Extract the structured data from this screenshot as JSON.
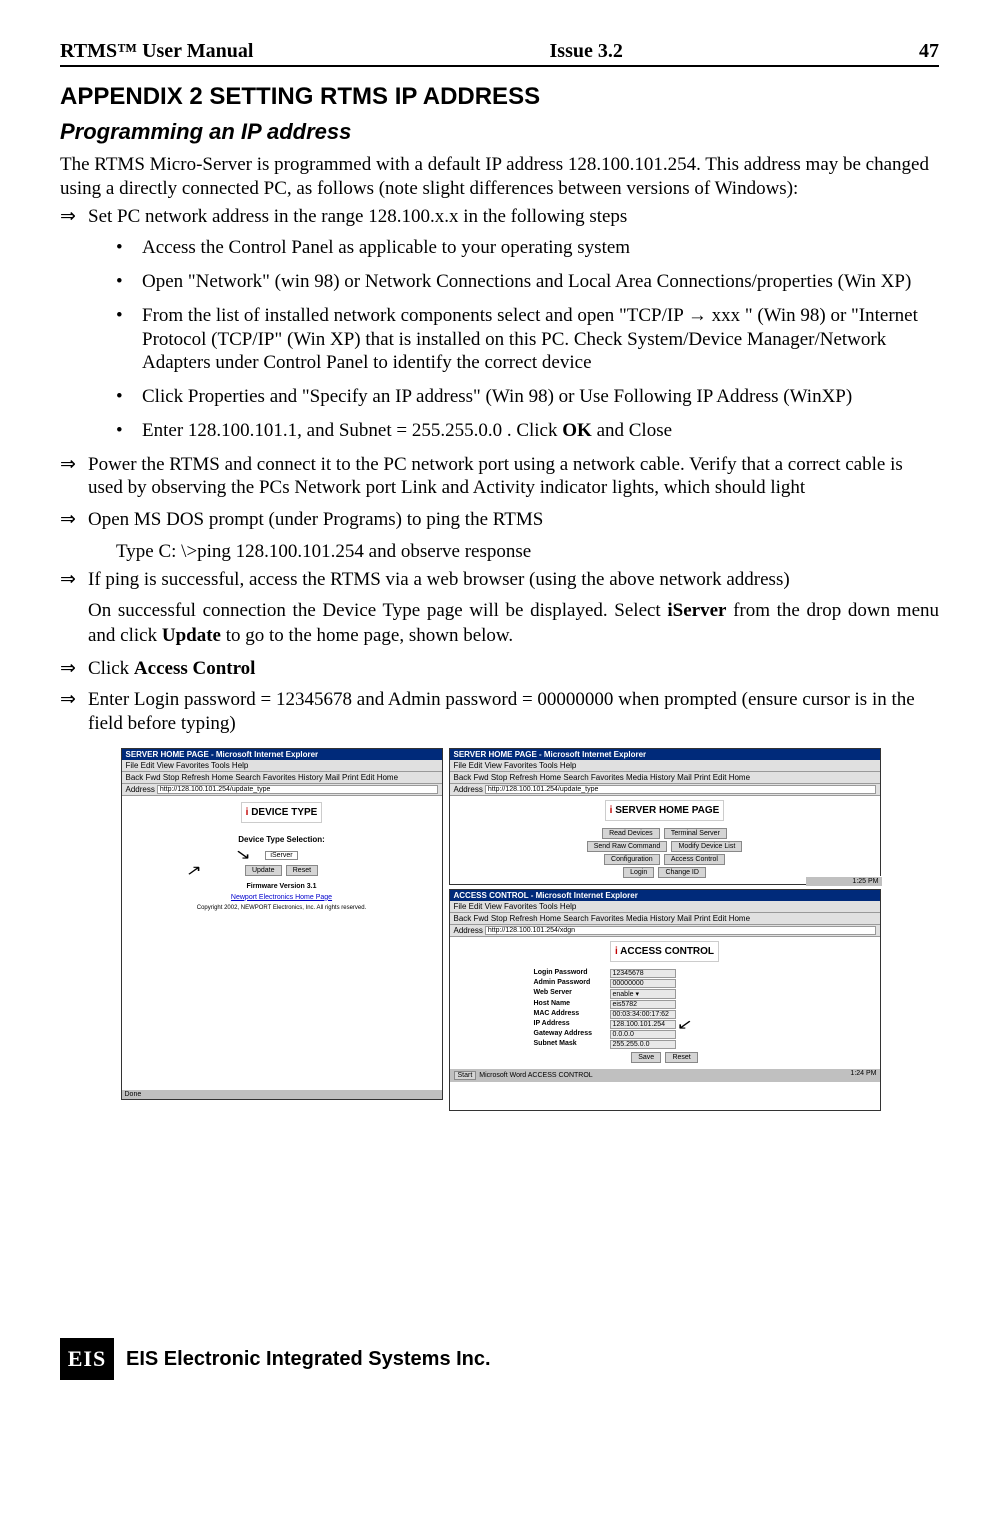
{
  "header": {
    "left": "RTMS™ User Manual",
    "center": "Issue 3.2",
    "right": "47"
  },
  "title": "APPENDIX 2     SETTING RTMS IP ADDRESS",
  "subtitle": "Programming an IP address",
  "intro": "The RTMS Micro-Server is programmed with a default IP address 128.100.101.254. This address may be changed using a directly connected PC, as follows (note slight differences between versions of Windows):",
  "arrows": {
    "a1": "Set PC network address in the range 128.100.x.x  in the following steps",
    "a2": "Power the RTMS and connect it to the PC network port using a network cable.  Verify that a correct cable is used by observing the PCs Network port Link and Activity indicator lights, which should light",
    "a3": "Open MS DOS prompt (under Programs)  to ping the RTMS",
    "a4": "If ping is successful, access the RTMS via a web browser (using the above network address)",
    "a5_pre": "Click  ",
    "a5_bold": "Access Control",
    "a6": "Enter Login password = 12345678 and Admin password = 00000000 when prompted (ensure cursor is in the field before typing)"
  },
  "bullets": {
    "b1": "Access the Control Panel as applicable to your operating system",
    "b2": "Open  \"Network\" (win 98) or Network Connections and Local Area Connections/properties (Win XP)",
    "b3": "From the list of installed network components select and open  \"TCP/IP → xxx \" (Win 98) or \"Internet Protocol (TCP/IP\" (Win XP) that is installed on this PC.   Check System/Device Manager/Network Adapters under Control Panel to identify the correct device",
    "b4": "Click Properties and \"Specify an IP address\"  (Win 98) or Use Following IP Address (WinXP)",
    "b5_pre": "Enter 128.100.101.1, and Subnet  = 255.255.0.0 .  Click ",
    "b5_bold": "OK",
    "b5_post": " and Close"
  },
  "indent1": "Type C: \\>ping 128.100.101.254 and observe response",
  "arrow_indent": {
    "pre": "On successful connection the Device Type page will be displayed. Select ",
    "bold1": "iServer",
    "mid": " from the drop down menu and click ",
    "bold2": "Update",
    "post": " to go to the home page, shown below."
  },
  "shots": {
    "w1": {
      "title": "SERVER HOME PAGE - Microsoft Internet Explorer",
      "menu": "File  Edit  View  Favorites  Tools  Help",
      "toolbar": "Back  Fwd  Stop  Refresh  Home  Search  Favorites  History  Mail  Print  Edit Home",
      "addr_label": "Address",
      "addr": "http://128.100.101.254/update_type",
      "heading": "DEVICE TYPE",
      "selection_label": "Device Type Selection:",
      "select_value": "iServer",
      "btn_update": "Update",
      "btn_reset": "Reset",
      "fw": "Firmware Version 3.1",
      "link": "Newport Electronics Home Page",
      "copyright": "Copyright 2002, NEWPORT Electronics, Inc. All rights reserved.",
      "status": "Done"
    },
    "w2": {
      "title": "SERVER HOME PAGE - Microsoft Internet Explorer",
      "menu": "File  Edit  View  Favorites  Tools  Help",
      "toolbar": "Back  Fwd  Stop  Refresh  Home  Search  Favorites  Media  History  Mail  Print  Edit Home",
      "addr_label": "Address",
      "addr": "http://128.100.101.254/update_type",
      "heading": "SERVER HOME PAGE",
      "btns": {
        "b1": "Read Devices",
        "b2": "Terminal Server",
        "b3": "Send Raw Command",
        "b4": "Modify Device List",
        "b5": "Configuration",
        "b6": "Access Control",
        "b7": "Login",
        "b8": "Change ID"
      },
      "taskbar_time": "1:25 PM"
    },
    "w3": {
      "title": "ACCESS CONTROL - Microsoft Internet Explorer",
      "menu": "File  Edit  View  Favorites  Tools  Help",
      "toolbar": "Back  Fwd  Stop  Refresh  Home  Search  Favorites  Media  History  Mail  Print  Edit Home",
      "addr_label": "Address",
      "addr": "http://128.100.101.254/xdgn",
      "heading": "ACCESS CONTROL",
      "rows": {
        "login_lbl": "Login Password",
        "login_val": "12345678",
        "admin_lbl": "Admin Password",
        "admin_val": "00000000",
        "ws_lbl": "Web Server",
        "ws_val": "enable ▾",
        "host_lbl": "Host Name",
        "host_val": "eis5782",
        "mac_lbl": "MAC Address",
        "mac_val": "00:03:34:00:17:62",
        "ip_lbl": "IP Address",
        "ip_val": "128.100.101.254",
        "gw_lbl": "Gateway Address",
        "gw_val": "0.0.0.0",
        "sub_lbl": "Subnet Mask",
        "sub_val": "255.255.0.0"
      },
      "btn_save": "Save",
      "btn_reset": "Reset",
      "taskbar_start": "Start",
      "taskbar_items": "Microsoft Word    ACCESS CONTROL",
      "taskbar_time": "1:24 PM"
    }
  },
  "footer": {
    "logo": "EIS",
    "text": "EIS Electronic Integrated Systems Inc."
  },
  "glyphs": {
    "double_arrow": "⇒",
    "bullet": "•"
  }
}
